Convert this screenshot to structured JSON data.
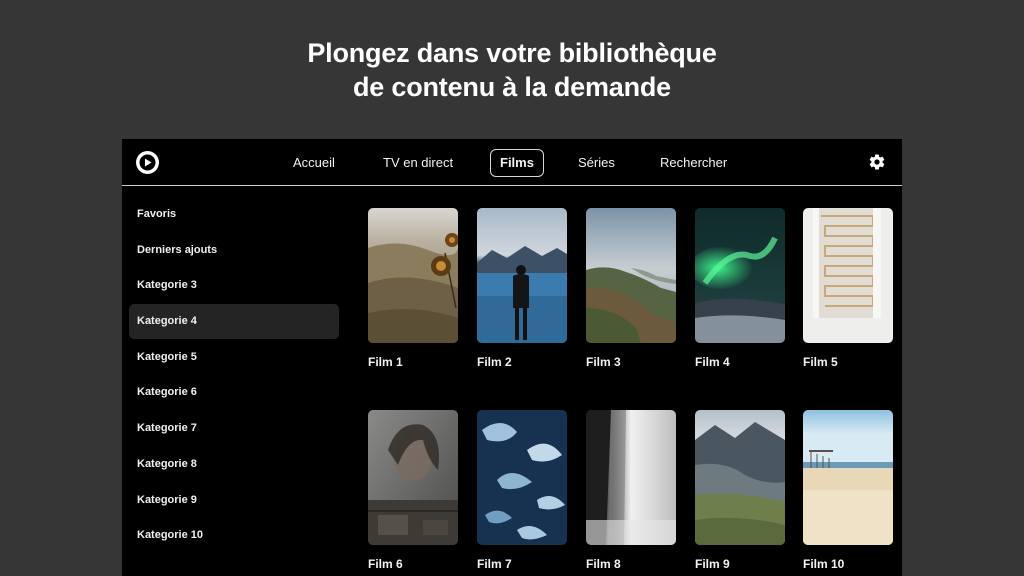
{
  "headline": {
    "line1": "Plongez dans votre bibliothèque",
    "line2": "de contenu à la demande"
  },
  "topbar": {
    "logo_icon": "play-circle-icon",
    "nav": [
      {
        "label": "Accueil",
        "active": false
      },
      {
        "label": "TV en direct",
        "active": false
      },
      {
        "label": "Films",
        "active": true
      },
      {
        "label": "Séries",
        "active": false
      },
      {
        "label": "Rechercher",
        "active": false
      }
    ],
    "settings_icon": "gear-icon"
  },
  "sidebar": {
    "items": [
      {
        "label": "Favoris",
        "active": false
      },
      {
        "label": "Derniers ajouts",
        "active": false
      },
      {
        "label": "Kategorie 3",
        "active": false
      },
      {
        "label": "Kategorie 4",
        "active": true
      },
      {
        "label": "Kategorie 5",
        "active": false
      },
      {
        "label": "Kategorie 6",
        "active": false
      },
      {
        "label": "Kategorie 7",
        "active": false
      },
      {
        "label": "Kategorie 8",
        "active": false
      },
      {
        "label": "Kategorie 9",
        "active": false
      },
      {
        "label": "Kategorie 10",
        "active": false
      }
    ]
  },
  "films": [
    {
      "title": "Film 1",
      "scene": "dry-hills-with-dried-flowers"
    },
    {
      "title": "Film 2",
      "scene": "person-standing-facing-mountain-lake"
    },
    {
      "title": "Film 3",
      "scene": "coastal-cliffs-and-sea"
    },
    {
      "title": "Film 4",
      "scene": "green-aurora-over-snowy-coast"
    },
    {
      "title": "Film 5",
      "scene": "white-spiral-staircase"
    },
    {
      "title": "Film 6",
      "scene": "woman-portrait-behind-glass"
    },
    {
      "title": "Film 7",
      "scene": "blue-abstract-birds"
    },
    {
      "title": "Film 8",
      "scene": "black-and-white-waterfall"
    },
    {
      "title": "Film 9",
      "scene": "misty-rocky-mountain"
    },
    {
      "title": "Film 10",
      "scene": "sandy-beach-with-pier"
    }
  ],
  "colors": {
    "page_background": "#363636",
    "app_background": "#000000",
    "text": "#ffffff",
    "active_sidebar": "#242424"
  }
}
